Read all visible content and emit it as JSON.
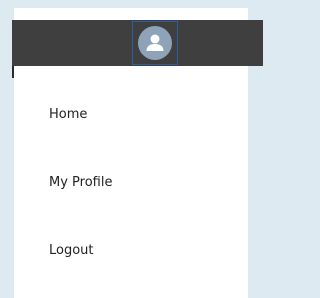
{
  "header": {
    "avatar_icon": "user-icon",
    "bar_color": "#3f3f3f",
    "avatar_color": "#8fa3b8"
  },
  "menu": {
    "items": [
      {
        "label": "Home"
      },
      {
        "label": "My Profile"
      },
      {
        "label": "Logout"
      }
    ]
  }
}
